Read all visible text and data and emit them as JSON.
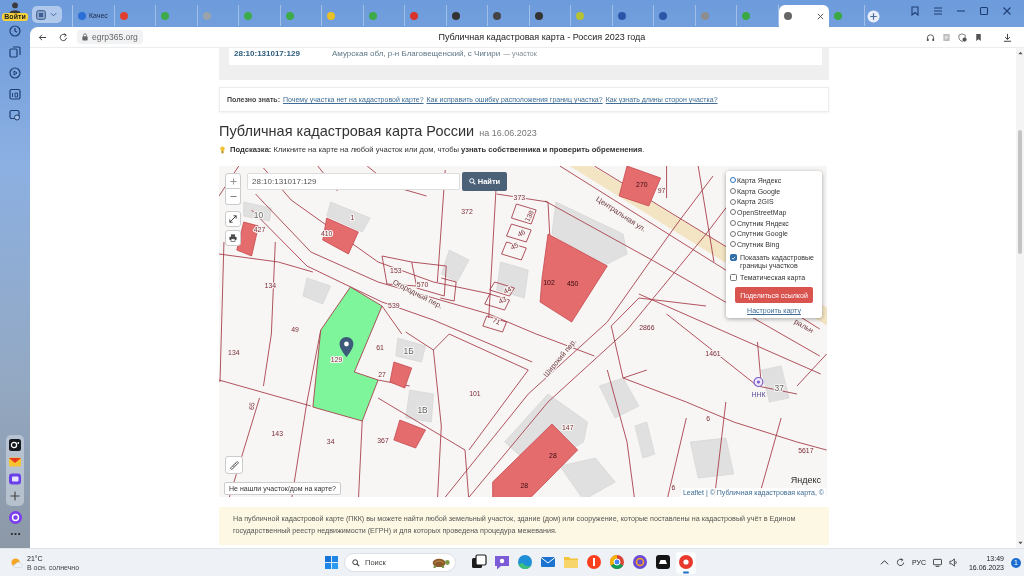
{
  "browser": {
    "profile_label": "Войти",
    "tabs": [
      {
        "title": "Качес",
        "color": "#2b6fd6",
        "selected": false
      },
      {
        "color": "#e0402f",
        "selected": false
      },
      {
        "color": "#3dab4a",
        "selected": false
      },
      {
        "color": "#9aa3ab",
        "selected": false
      },
      {
        "color": "#3dab4a",
        "selected": false
      },
      {
        "color": "#3dab4a",
        "selected": false
      },
      {
        "color": "#e8c02a",
        "selected": false
      },
      {
        "color": "#3dab4a",
        "selected": false
      },
      {
        "color": "#d9342b",
        "selected": false
      },
      {
        "color": "#333333",
        "selected": false
      },
      {
        "color": "#444444",
        "selected": false
      },
      {
        "color": "#333333",
        "selected": false
      },
      {
        "color": "#b5c234",
        "selected": false
      },
      {
        "color": "#2a56a8",
        "selected": false
      },
      {
        "color": "#2a56a8",
        "selected": false
      },
      {
        "color": "#8d8d8d",
        "selected": false
      },
      {
        "color": "#3aa845",
        "selected": false
      },
      {
        "color": "#666666",
        "selected": true
      },
      {
        "color": "#3aa845",
        "selected": false
      }
    ],
    "url": "egrp365.org",
    "page_title": "Публичная кадастровая карта - Россия 2023 года"
  },
  "record": {
    "cadastral_number": "28:10:131017:129",
    "address": "Амурская обл, р-н Благовещенский, с Чигири",
    "type": "— участок"
  },
  "useful": {
    "label": "Полезно знать:",
    "links": [
      "Почему участка нет на кадастровой карте?",
      "Как исправить ошибку расположения границ участка?",
      "Как узнать длины сторон участка?"
    ]
  },
  "heading": {
    "title": "Публичная кадастровая карта России",
    "date": "на 16.06.2023"
  },
  "hint": "**Подсказка:** Кликните на карте на любой участок или дом, чтобы **узнать собственника и проверить обременения**.",
  "map": {
    "search": {
      "value": "28:10:131017:129"
    },
    "search_button": "Найти",
    "layers": [
      {
        "label": "Карта Яндекс",
        "selected": true
      },
      {
        "label": "Карта Google",
        "selected": false
      },
      {
        "label": "Карта 2GIS",
        "selected": false
      },
      {
        "label": "OpenStreetMap",
        "selected": false
      },
      {
        "label": "Спутник Яндекс",
        "selected": false
      },
      {
        "label": "Спутник Google",
        "selected": false
      },
      {
        "label": "Спутник Bing",
        "selected": false
      }
    ],
    "options": [
      {
        "label": "Показать кадастровые границы участков",
        "checked": true
      },
      {
        "label": "Тематическая карта",
        "checked": false
      }
    ],
    "share_button": "Поделиться ссылкой",
    "settings_link": "Настроить карту",
    "not_found_button": "Не нашли участок/дом на карте?",
    "logo": "Яндекс",
    "attribution": {
      "link": "Leaflet",
      "text": "| © Публичная кадастровая карта, ©"
    },
    "labels": [
      {
        "text": "372",
        "kind": "parcel"
      },
      {
        "text": "373",
        "kind": "parcel"
      },
      {
        "text": "1",
        "kind": "parcel"
      },
      {
        "text": "410",
        "kind": "parcel"
      },
      {
        "text": "10",
        "kind": "house"
      },
      {
        "text": "427",
        "kind": "parcel"
      },
      {
        "text": "153",
        "kind": "parcel"
      },
      {
        "text": "570",
        "kind": "parcel"
      },
      {
        "text": "539",
        "kind": "parcel"
      },
      {
        "text": "134",
        "kind": "parcel"
      },
      {
        "text": "49",
        "kind": "parcel"
      },
      {
        "text": "134",
        "kind": "parcel"
      },
      {
        "text": "129",
        "kind": "parcel"
      },
      {
        "text": "61",
        "kind": "parcel"
      },
      {
        "text": "1Б",
        "kind": "house"
      },
      {
        "text": "27",
        "kind": "parcel"
      },
      {
        "text": "101",
        "kind": "parcel"
      },
      {
        "text": "1В",
        "kind": "house"
      },
      {
        "text": "143",
        "kind": "parcel"
      },
      {
        "text": "34",
        "kind": "parcel"
      },
      {
        "text": "367",
        "kind": "parcel"
      },
      {
        "text": "147",
        "kind": "parcel"
      },
      {
        "text": "2866",
        "kind": "parcel"
      },
      {
        "text": "1461",
        "kind": "parcel"
      },
      {
        "text": "5617",
        "kind": "parcel"
      },
      {
        "text": "102",
        "kind": "building"
      },
      {
        "text": "450",
        "kind": "building"
      },
      {
        "text": "44",
        "kind": "parcel"
      },
      {
        "text": "43",
        "kind": "parcel"
      },
      {
        "text": "46",
        "kind": "parcel"
      },
      {
        "text": "45",
        "kind": "parcel"
      },
      {
        "text": "138",
        "kind": "parcel"
      },
      {
        "text": "71",
        "kind": "parcel"
      },
      {
        "text": "97",
        "kind": "parcel"
      },
      {
        "text": "270",
        "kind": "building"
      },
      {
        "text": "28",
        "kind": "building"
      },
      {
        "text": "28",
        "kind": "building"
      },
      {
        "text": "65",
        "kind": "parcel"
      },
      {
        "text": "6",
        "kind": "parcel"
      },
      {
        "text": "6",
        "kind": "parcel"
      },
      {
        "text": "37",
        "kind": "house"
      },
      {
        "text": "ННК",
        "kind": "poi"
      },
      {
        "text": "Центральная ул.",
        "kind": "street"
      },
      {
        "text": "Огородный пер.",
        "kind": "street"
      },
      {
        "text": "Широкий пер.",
        "kind": "street"
      },
      {
        "text": "ральн",
        "kind": "street"
      }
    ]
  },
  "note": "На публичной кадастровой карте (ПКК) вы можете найти любой земельный участок, здание (дом) или сооружение, которые поставлены на кадастровый учёт в Едином государственный реестр недвижимости (ЕГРН) и для которых проведена процедура межевания.",
  "taskbar": {
    "weather": {
      "temperature": "21°C",
      "condition": "В осн. солнечно"
    },
    "search": {
      "placeholder": "Поиск"
    },
    "apps": [
      {
        "kind": "taskview",
        "active": false
      },
      {
        "kind": "chat",
        "active": false
      },
      {
        "kind": "edge",
        "active": false
      },
      {
        "kind": "mail",
        "active": false
      },
      {
        "kind": "explorer",
        "active": false
      },
      {
        "kind": "yandex",
        "active": false
      },
      {
        "kind": "chrome",
        "active": false
      },
      {
        "kind": "app",
        "active": false
      },
      {
        "kind": "game",
        "active": false
      },
      {
        "kind": "ybrowser",
        "active": true
      }
    ],
    "language": "РУС",
    "time": "13:49",
    "date": "16.06.2023",
    "notifications": "1"
  }
}
